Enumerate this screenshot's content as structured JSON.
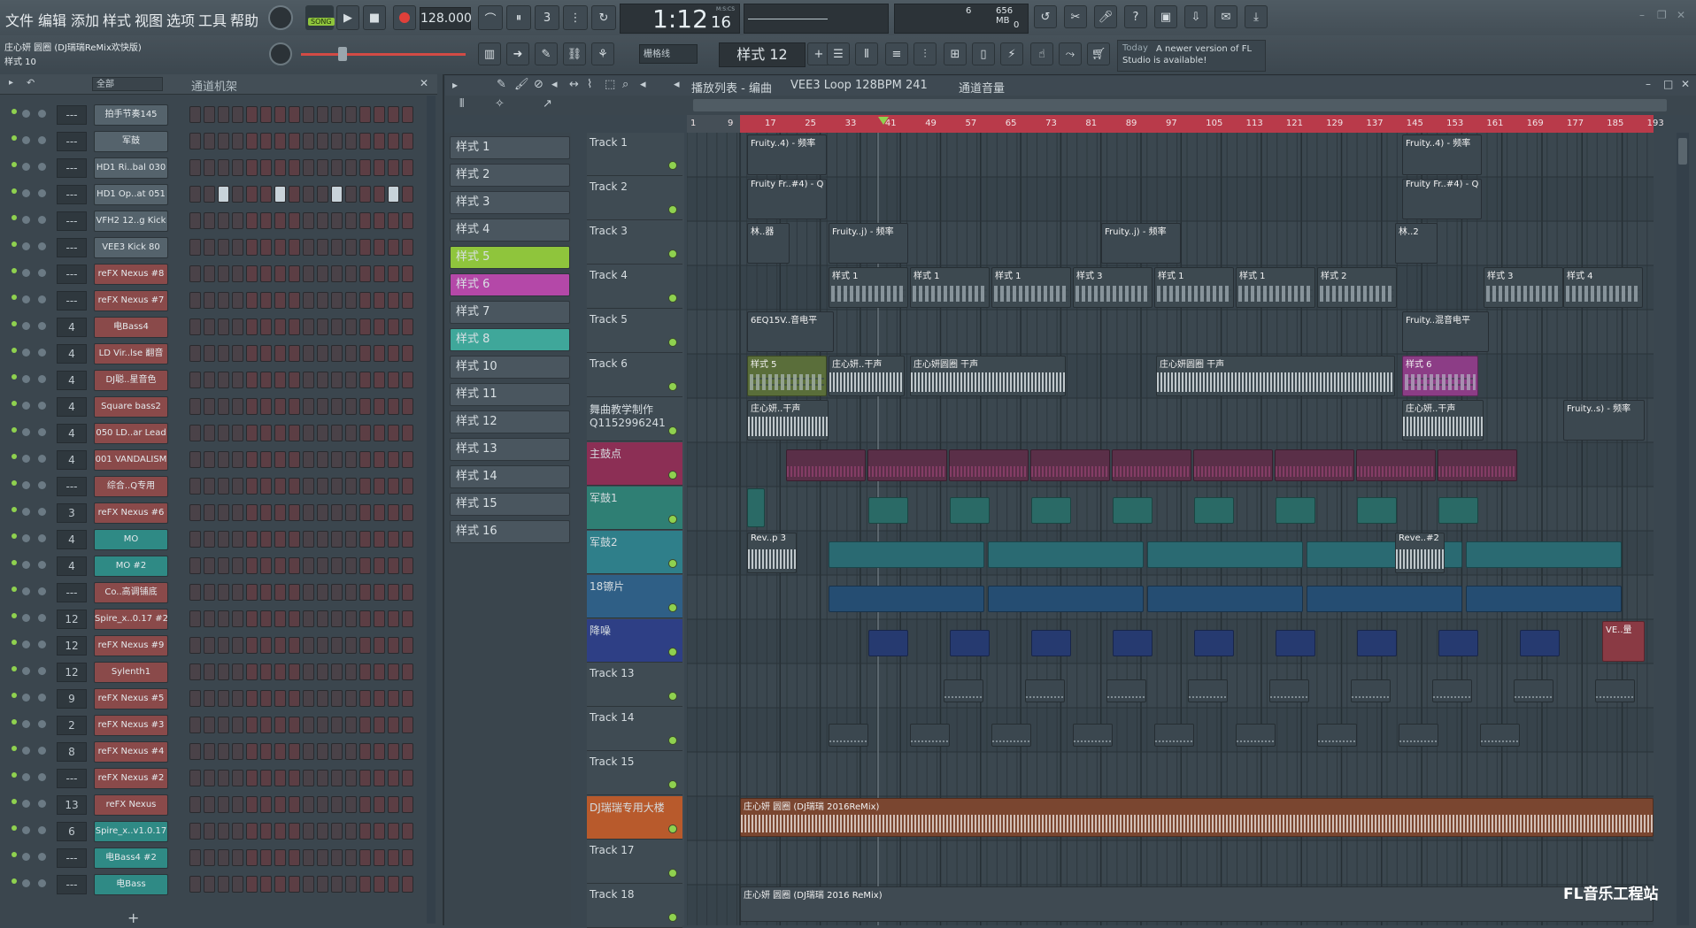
{
  "menu": [
    "文件",
    "编辑",
    "添加",
    "样式",
    "视图",
    "选项",
    "工具",
    "帮助"
  ],
  "transport": {
    "mode": "SONG",
    "tempo": "128.000",
    "time": "1:12",
    "time_sub": "16",
    "time_label": "M:S:CS",
    "cpu": "6",
    "mem": "656 MB",
    "poly": "0"
  },
  "project": {
    "title": "庄心妍 圆圈 (DJ瑞瑞ReMix欢快版)",
    "pattern": "样式 10"
  },
  "snap": "栅格线",
  "current_pattern": "样式 12",
  "news": {
    "day": "Today",
    "text": "A newer version of FL Studio is available!"
  },
  "rack": {
    "filter": "全部",
    "title": "通道机架",
    "channels": [
      {
        "num": "---",
        "name": "拍手节奏145",
        "color": "#55636c"
      },
      {
        "num": "---",
        "name": "军鼓",
        "color": "#55636c"
      },
      {
        "num": "---",
        "name": "HD1 Ri..bal 030",
        "color": "#55636c"
      },
      {
        "num": "---",
        "name": "HD1 Op..at 051",
        "color": "#55636c"
      },
      {
        "num": "---",
        "name": "VFH2 12..g Kick",
        "color": "#55636c"
      },
      {
        "num": "---",
        "name": "VEE3 Kick 80",
        "color": "#55636c"
      },
      {
        "num": "---",
        "name": "reFX Nexus #8",
        "color": "#8a4a4a"
      },
      {
        "num": "---",
        "name": "reFX Nexus #7",
        "color": "#8a4a4a"
      },
      {
        "num": "4",
        "name": "电Bass4",
        "color": "#8a4a4a"
      },
      {
        "num": "4",
        "name": "LD Vir..lse 翻音",
        "color": "#8a4a4a"
      },
      {
        "num": "4",
        "name": "DJ聪..星音色",
        "color": "#8a4a4a"
      },
      {
        "num": "4",
        "name": "Square bass2",
        "color": "#8a4a4a"
      },
      {
        "num": "4",
        "name": "050 LD..ar Lead",
        "color": "#8a4a4a"
      },
      {
        "num": "4",
        "name": "001 VANDALISM",
        "color": "#8a4a4a"
      },
      {
        "num": "---",
        "name": "综合..Q专用",
        "color": "#8a4a4a"
      },
      {
        "num": "3",
        "name": "reFX Nexus #6",
        "color": "#8a4a4a"
      },
      {
        "num": "4",
        "name": "MO",
        "color": "#2f8a85"
      },
      {
        "num": "4",
        "name": "MO #2",
        "color": "#2f8a85"
      },
      {
        "num": "---",
        "name": "Co..高调铺底",
        "color": "#8a4a4a"
      },
      {
        "num": "12",
        "name": "Spire_x..0.17 #2",
        "color": "#8a4a4a"
      },
      {
        "num": "12",
        "name": "reFX Nexus #9",
        "color": "#8a4a4a"
      },
      {
        "num": "12",
        "name": "Sylenth1",
        "color": "#8a4a4a"
      },
      {
        "num": "9",
        "name": "reFX Nexus #5",
        "color": "#8a4a4a"
      },
      {
        "num": "2",
        "name": "reFX Nexus #3",
        "color": "#8a4a4a"
      },
      {
        "num": "8",
        "name": "reFX Nexus #4",
        "color": "#8a4a4a"
      },
      {
        "num": "---",
        "name": "reFX Nexus #2",
        "color": "#8a4a4a"
      },
      {
        "num": "13",
        "name": "reFX Nexus",
        "color": "#8a4a4a"
      },
      {
        "num": "6",
        "name": "Spire_x..v1.0.17",
        "color": "#2f8a85"
      },
      {
        "num": "---",
        "name": "电Bass4 #2",
        "color": "#2f8a85"
      },
      {
        "num": "---",
        "name": "电Bass",
        "color": "#2f8a85"
      }
    ]
  },
  "patterns": [
    {
      "name": "样式 1",
      "color": "#4a565f"
    },
    {
      "name": "样式 2",
      "color": "#4a565f"
    },
    {
      "name": "样式 3",
      "color": "#4a565f"
    },
    {
      "name": "样式 4",
      "color": "#4a565f"
    },
    {
      "name": "样式 5",
      "color": "#8fc53c"
    },
    {
      "name": "样式 6",
      "color": "#b448a8"
    },
    {
      "name": "样式 7",
      "color": "#4a565f"
    },
    {
      "name": "样式 8",
      "color": "#3fa79a"
    },
    {
      "name": "样式 10",
      "color": "#4a565f"
    },
    {
      "name": "样式 11",
      "color": "#4a565f"
    },
    {
      "name": "样式 12",
      "color": "#4a565f"
    },
    {
      "name": "样式 13",
      "color": "#4a565f"
    },
    {
      "name": "样式 14",
      "color": "#4a565f"
    },
    {
      "name": "样式 15",
      "color": "#4a565f"
    },
    {
      "name": "样式 16",
      "color": "#4a565f"
    }
  ],
  "playlist": {
    "breadcrumb": [
      "播放列表 - 编曲",
      "VEE3 Loop 128BPM 241",
      "通道音量"
    ],
    "ruler": [
      "1",
      "9",
      "17",
      "25",
      "33",
      "41",
      "49",
      "57",
      "65",
      "73",
      "81",
      "89",
      "97",
      "105",
      "113",
      "121",
      "129",
      "137",
      "145",
      "153",
      "161",
      "169",
      "177",
      "185",
      "193"
    ],
    "tracks": [
      {
        "name": "Track 1",
        "color": "#3f4b53"
      },
      {
        "name": "Track 2",
        "color": "#3f4b53"
      },
      {
        "name": "Track 3",
        "color": "#3f4b53"
      },
      {
        "name": "Track 4",
        "color": "#3f4b53"
      },
      {
        "name": "Track 5",
        "color": "#3f4b53"
      },
      {
        "name": "Track 6",
        "color": "#3f4b53"
      },
      {
        "name": "舞曲教学制作 Q1152996241",
        "color": "#3f4b53"
      },
      {
        "name": "主鼓点",
        "color": "#8c2f55"
      },
      {
        "name": "军鼓1",
        "color": "#2f7f74"
      },
      {
        "name": "军鼓2",
        "color": "#2f7f8a"
      },
      {
        "name": "18镲片",
        "color": "#2f5f86"
      },
      {
        "name": "降噪",
        "color": "#2e3f85"
      },
      {
        "name": "Track 13",
        "color": "#3f4b53"
      },
      {
        "name": "Track 14",
        "color": "#3f4b53"
      },
      {
        "name": "Track 15",
        "color": "#3f4b53"
      },
      {
        "name": "DJ瑞瑞专用大楼",
        "color": "#b85a2c"
      },
      {
        "name": "Track 17",
        "color": "#3f4b53"
      },
      {
        "name": "Track 18",
        "color": "#3f4b53"
      }
    ],
    "clips": {
      "fruity4": "Fruity..4) - 频率",
      "fruity_fr": "Fruity Fr..#4) - Q",
      "lin": "林..器",
      "fruity_j": "Fruity..j) - 频率",
      "lin2": "林..2",
      "p1": "样式 1",
      "p2": "样式 2",
      "p3": "样式 3",
      "p4": "样式 4",
      "p5": "样式 5",
      "p6": "样式 6",
      "eq": "6EQ15V..音电平",
      "fruity_mix": "Fruity..混音电平",
      "zx_dry": "庄心妍..干声",
      "zx_loop": "庄心妍圆圈 干声",
      "fruity_s": "Fruity..s) - 频率",
      "rev3": "Rev..p 3",
      "rev2": "Reve..#2",
      "ve": "VE..量",
      "main": "庄心妍 圆圈 (DJ瑞瑞 2016ReMix)",
      "main2": "庄心妍 圆圈 (DJ瑞瑞 2016 ReMix)"
    }
  },
  "watermark": "FL音乐工程站"
}
